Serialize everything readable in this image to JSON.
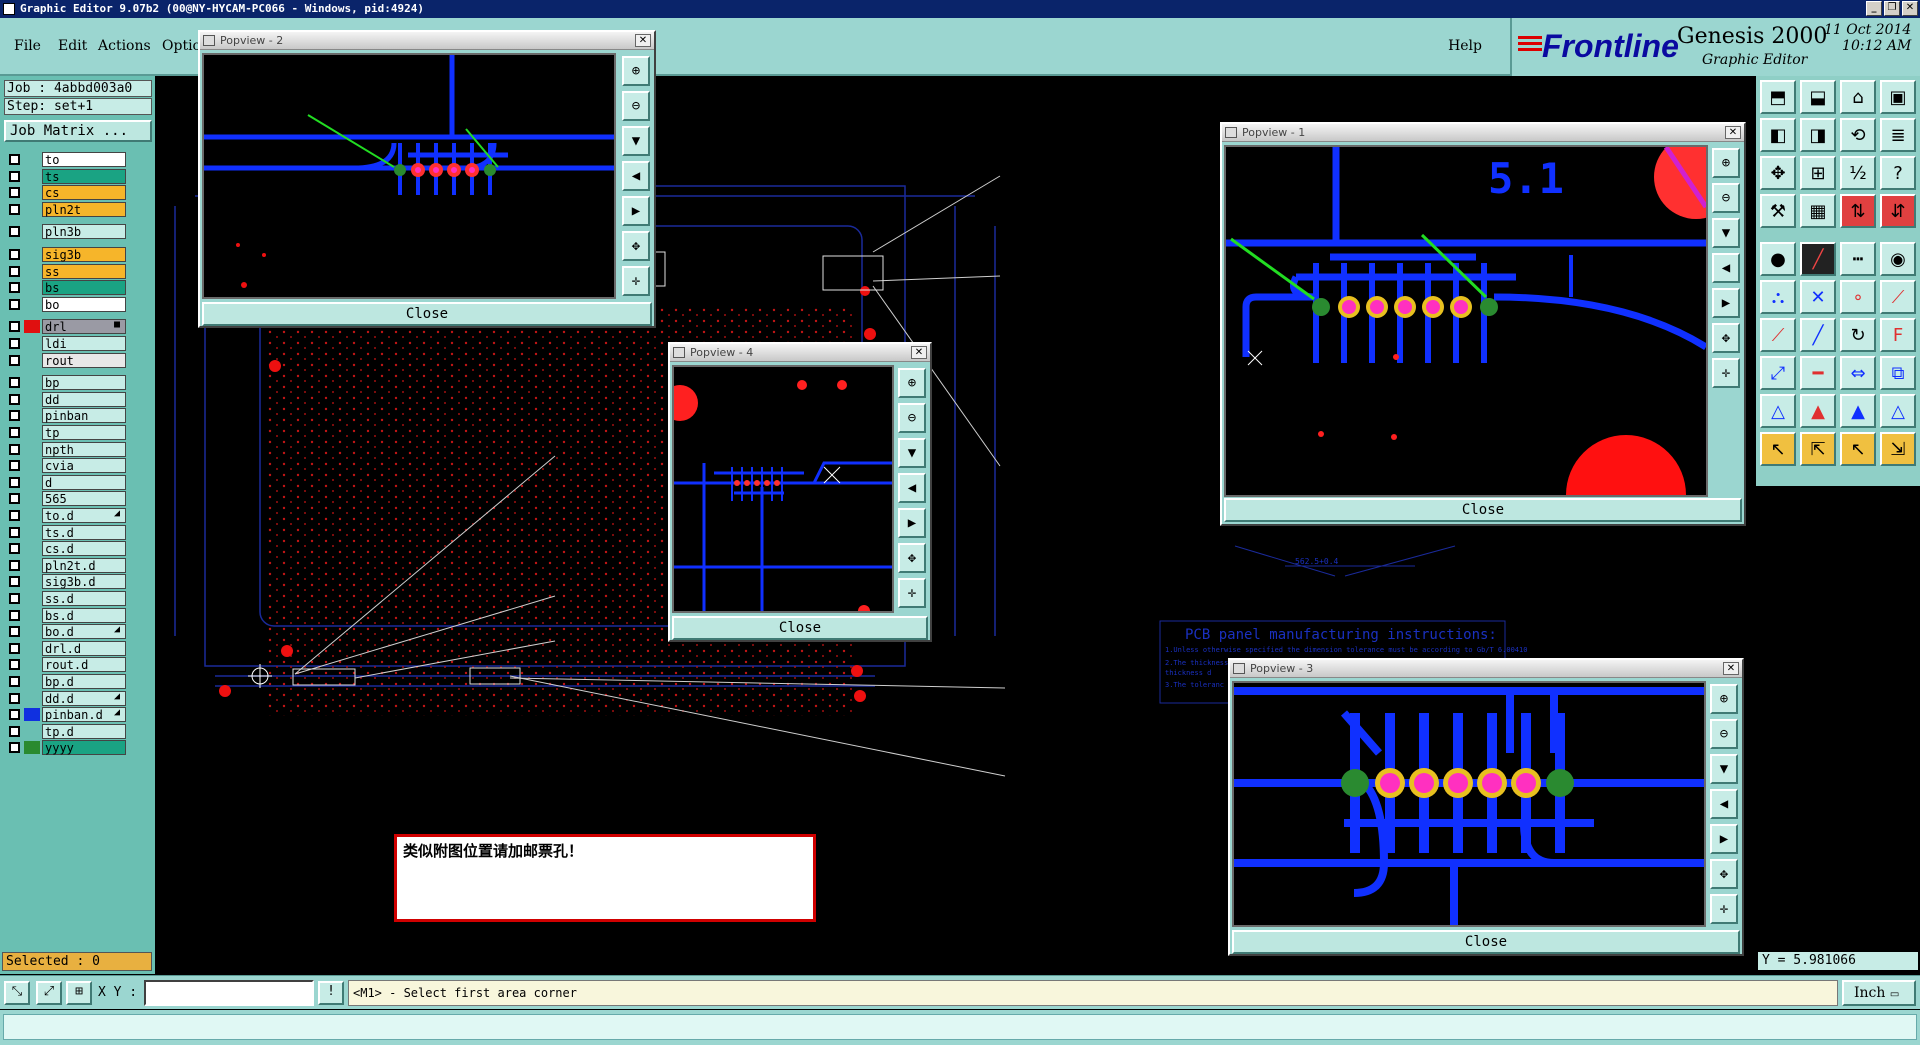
{
  "window": {
    "title": "Graphic Editor 9.07b2 (00@NY-HYCAM-PC066 - Windows, pid:4924)",
    "buttons": [
      "_",
      "❐",
      "✕"
    ]
  },
  "menu": {
    "file": "File",
    "edit": "Edit",
    "actions": "Actions",
    "options": "Optio",
    "help": "Help"
  },
  "logo": {
    "brand": "Frontline",
    "product": "Genesis 2000",
    "subtitle": "Graphic Editor",
    "date": "11 Oct 2014",
    "time": "10:12 AM"
  },
  "left": {
    "job": "Job : 4abbd003a0",
    "step": "Step: set+1",
    "job_matrix": "Job Matrix ...",
    "selected": "Selected : 0",
    "layers": [
      {
        "name": "to",
        "bg": "#ffffff",
        "swatch": ""
      },
      {
        "name": "ts",
        "bg": "#1aa383",
        "swatch": ""
      },
      {
        "name": "cs",
        "bg": "#f6b52a",
        "swatch": ""
      },
      {
        "name": "pln2t",
        "bg": "#f6b52a",
        "swatch": ""
      },
      {
        "name": "pln3b",
        "bg": "#c7ece6",
        "swatch": ""
      },
      {
        "name": "sig3b",
        "bg": "#f6b52a",
        "swatch": ""
      },
      {
        "name": "ss",
        "bg": "#f6b52a",
        "swatch": ""
      },
      {
        "name": "bs",
        "bg": "#1aa383",
        "swatch": ""
      },
      {
        "name": "bo",
        "bg": "#ffffff",
        "swatch": ""
      },
      {
        "name": "drl",
        "bg": "#9a9aa4",
        "swatch": "#e01010",
        "flag": "■"
      },
      {
        "name": "ldi",
        "bg": "#c7ece6",
        "swatch": ""
      },
      {
        "name": "rout",
        "bg": "#e8e8e8",
        "swatch": ""
      },
      {
        "name": "bp",
        "bg": "#c7ece6",
        "swatch": ""
      },
      {
        "name": "dd",
        "bg": "#c7ece6",
        "swatch": ""
      },
      {
        "name": "pinban",
        "bg": "#c7ece6",
        "swatch": ""
      },
      {
        "name": "tp",
        "bg": "#c7ece6",
        "swatch": ""
      },
      {
        "name": "npth",
        "bg": "#c7ece6",
        "swatch": ""
      },
      {
        "name": "cvia",
        "bg": "#c7ece6",
        "swatch": ""
      },
      {
        "name": "d",
        "bg": "#c7ece6",
        "swatch": ""
      },
      {
        "name": "565",
        "bg": "#c7ece6",
        "swatch": ""
      },
      {
        "name": "to.d",
        "bg": "#c7ece6",
        "swatch": "",
        "flag": "◢"
      },
      {
        "name": "ts.d",
        "bg": "#c7ece6",
        "swatch": ""
      },
      {
        "name": "cs.d",
        "bg": "#c7ece6",
        "swatch": ""
      },
      {
        "name": "pln2t.d",
        "bg": "#c7ece6",
        "swatch": ""
      },
      {
        "name": "sig3b.d",
        "bg": "#c7ece6",
        "swatch": ""
      },
      {
        "name": "ss.d",
        "bg": "#c7ece6",
        "swatch": ""
      },
      {
        "name": "bs.d",
        "bg": "#c7ece6",
        "swatch": ""
      },
      {
        "name": "bo.d",
        "bg": "#c7ece6",
        "swatch": "",
        "flag": "◢"
      },
      {
        "name": "drl.d",
        "bg": "#c7ece6",
        "swatch": ""
      },
      {
        "name": "rout.d",
        "bg": "#c7ece6",
        "swatch": ""
      },
      {
        "name": "bp.d",
        "bg": "#c7ece6",
        "swatch": ""
      },
      {
        "name": "dd.d",
        "bg": "#c7ece6",
        "swatch": "",
        "flag": "◢"
      },
      {
        "name": "pinban.d",
        "bg": "#c7ece6",
        "swatch": "#1030e0",
        "flag": "◢"
      },
      {
        "name": "tp.d",
        "bg": "#c7ece6",
        "swatch": ""
      },
      {
        "name": "yyyy",
        "bg": "#1aa383",
        "swatch": "#2a8a30"
      }
    ]
  },
  "popviews": {
    "pv2": {
      "title": "Popview - 2",
      "close": "Close"
    },
    "pv4": {
      "title": "Popview - 4",
      "close": "Close"
    },
    "pv1": {
      "title": "Popview - 1",
      "close": "Close",
      "label": "5.1"
    },
    "pv3": {
      "title": "Popview - 3",
      "close": "Close"
    }
  },
  "canvas": {
    "note": "类似附图位置请加邮票孔！",
    "panel_title": "PCB panel manufacturing instructions:",
    "panel_lines": [
      "1.Unless otherwise specified the dimension tolerance must be according to Gb/T 6.00410",
      "2.The thickness",
      "  thickness d",
      "3.The toleranc"
    ],
    "dim_label": "562.5+0.4"
  },
  "right": {
    "y_readout": "Y = 5.981066"
  },
  "bottom": {
    "xy_label": "X Y :",
    "xy_value": "",
    "prompt": "<M1> - Select first area corner",
    "unit": "Inch",
    "cmd_icons": [
      "zoom-area-icon",
      "zoom-fit-icon",
      "grid-icon"
    ],
    "info_btn": "!"
  },
  "colors": {
    "accent": "#9bd6d0",
    "trace": "#1030ff",
    "pad": "#ff1010",
    "arrow": "#22dd22"
  }
}
